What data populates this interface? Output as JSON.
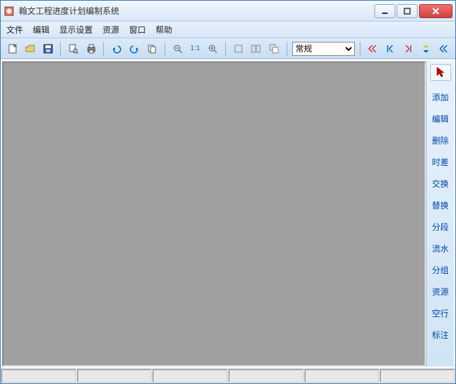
{
  "titlebar": {
    "title": "翰文工程进度计划编制系统"
  },
  "menu": {
    "file": "文件",
    "edit": "编辑",
    "display": "显示设置",
    "resource": "资源",
    "window": "窗口",
    "help": "帮助"
  },
  "toolbar": {
    "new": "new-icon",
    "open": "open-icon",
    "save": "save-icon",
    "preview": "preview-icon",
    "print": "print-icon",
    "undo": "undo-icon",
    "redo": "redo-icon",
    "copy": "copy-icon",
    "zoomout": "zoomout-icon",
    "zoom11": "1:1",
    "zoomin": "zoomin-icon",
    "win1": "window-icon",
    "win2": "windows-icon",
    "win3": "cascade-icon",
    "dropdown_value": "常规",
    "nav1": "nav-icon",
    "nav2": "nav-icon",
    "nav3": "nav-icon",
    "nav4": "nav-icon"
  },
  "side": {
    "items": [
      {
        "label": "添加"
      },
      {
        "label": "编辑"
      },
      {
        "label": "删除"
      },
      {
        "label": "时差"
      },
      {
        "label": "交换"
      },
      {
        "label": "替换"
      },
      {
        "label": "分段"
      },
      {
        "label": "流水"
      },
      {
        "label": "分组"
      },
      {
        "label": "资源"
      },
      {
        "label": "空行"
      },
      {
        "label": "标注"
      }
    ]
  }
}
